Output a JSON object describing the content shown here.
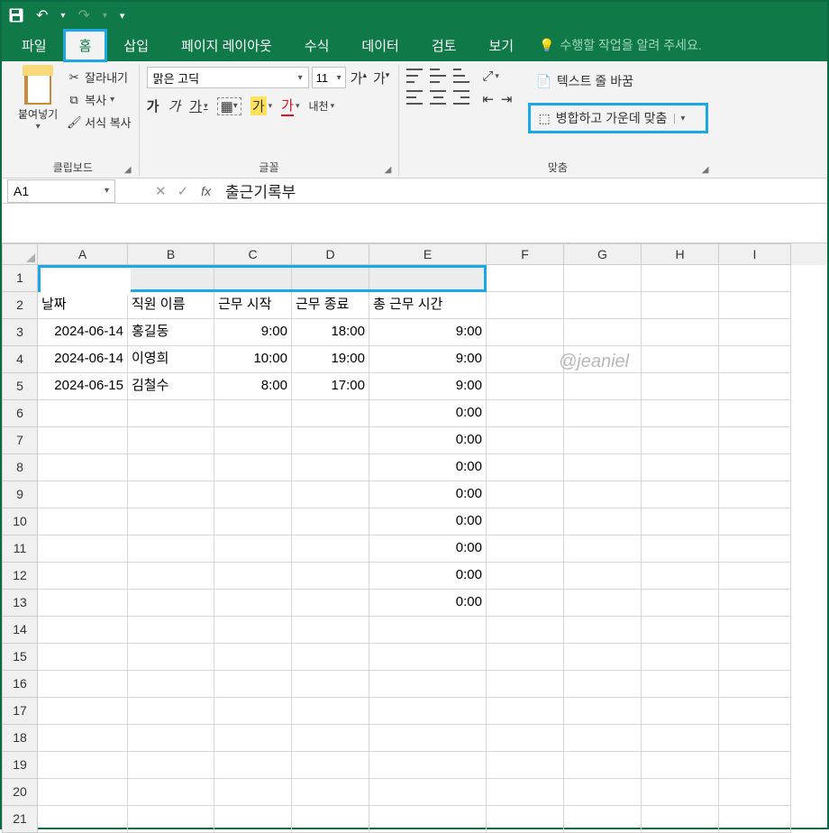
{
  "quickAccess": {
    "save": "💾",
    "undo": "↶",
    "redo": "↷",
    "customize": "▾"
  },
  "tabs": {
    "file": "파일",
    "home": "홈",
    "insert": "삽입",
    "pageLayout": "페이지 레이아웃",
    "formulas": "수식",
    "data": "데이터",
    "review": "검토",
    "view": "보기"
  },
  "tellMe": "수행할 작업을 알려 주세요.",
  "ribbon": {
    "clipboard": {
      "paste": "붙여넣기",
      "cut": "잘라내기",
      "copy": "복사",
      "formatPainter": "서식 복사",
      "label": "클립보드"
    },
    "font": {
      "name": "맑은 고딕",
      "size": "11",
      "bold": "가",
      "italic": "가",
      "underline": "가",
      "label": "글꼴",
      "hangul": "내천"
    },
    "alignment": {
      "wrapText": "텍스트 줄 바꿈",
      "mergeCenter": "병합하고 가운데 맞춤",
      "label": "맞춤"
    }
  },
  "nameBox": "A1",
  "formulaValue": "출근기록부",
  "columns": [
    "A",
    "B",
    "C",
    "D",
    "E",
    "F",
    "G",
    "H",
    "I"
  ],
  "rowNumbers": [
    1,
    2,
    3,
    4,
    5,
    6,
    7,
    8,
    9,
    10,
    11,
    12,
    13,
    14,
    15,
    16,
    17,
    18,
    19,
    20,
    21
  ],
  "data": {
    "title": "출근기록부",
    "headers": {
      "date": "날짜",
      "name": "직원 이름",
      "start": "근무 시작",
      "end": "근무 종료",
      "total": "총 근무 시간"
    },
    "rows": [
      {
        "date": "2024-06-14",
        "name": "홍길동",
        "start": "9:00",
        "end": "18:00",
        "total": "9:00"
      },
      {
        "date": "2024-06-14",
        "name": "이영희",
        "start": "10:00",
        "end": "19:00",
        "total": "9:00"
      },
      {
        "date": "2024-06-15",
        "name": "김철수",
        "start": "8:00",
        "end": "17:00",
        "total": "9:00"
      }
    ],
    "zeroTotal": "0:00"
  },
  "watermark": "@jeaniel"
}
